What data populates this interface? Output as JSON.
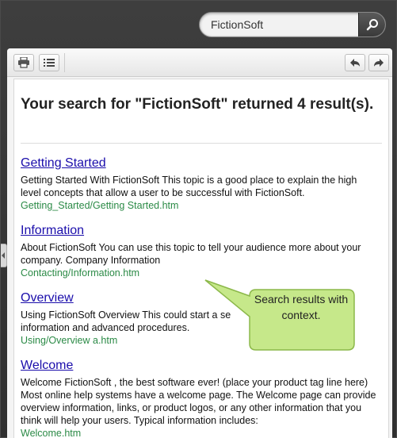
{
  "search": {
    "value": "FictionSoft"
  },
  "toolbar": {
    "print_icon": "printer-icon",
    "toc_icon": "list-icon",
    "back_icon": "back-arrow-icon",
    "forward_icon": "forward-arrow-icon"
  },
  "results_heading": "Your search for \"FictionSoft\" returned 4 result(s).",
  "results": [
    {
      "title": "Getting Started",
      "summary": "Getting Started With FictionSoft This topic is a good place to explain the high level concepts that allow a user to be successful with FictionSoft.",
      "url": "Getting_Started/Getting Started.htm"
    },
    {
      "title": "Information",
      "summary": "About FictionSoft You can use this topic to tell your audience more about your company. Company Information",
      "url": "Contacting/Information.htm"
    },
    {
      "title": "Overview",
      "summary": "Using FictionSoft Overview This could start a se information and advanced procedures.",
      "url": "Using/Overview a.htm"
    },
    {
      "title": "Welcome",
      "summary": "Welcome FictionSoft , the best software ever! (place your product tag line here) Most online help systems have a welcome page. The Welcome page can provide overview information, links, or product logos, or any other information that you think will help your users. Typical information includes:",
      "url": "Welcome.htm"
    }
  ],
  "callout": {
    "text": "Search results with context."
  },
  "colors": {
    "link": "#1a0dab",
    "url": "#2b8a46",
    "callout_fill": "#c6e88a",
    "frame": "#3a3a3a"
  }
}
